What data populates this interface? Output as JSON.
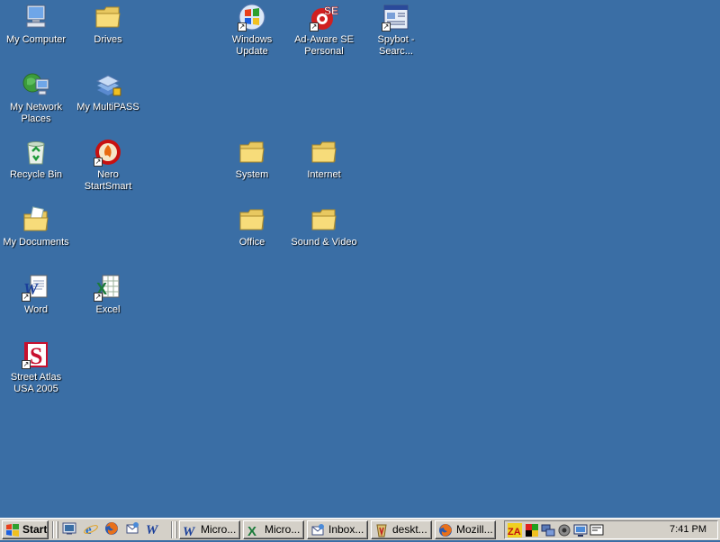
{
  "desktop": {
    "icons": [
      {
        "label": "My Computer",
        "icon": "computer-icon"
      },
      {
        "label": "Drives",
        "icon": "folder-icon"
      },
      {
        "label": "Windows Update",
        "icon": "windows-update-icon"
      },
      {
        "label": "Ad-Aware SE Personal",
        "icon": "ad-aware-icon"
      },
      {
        "label": "Spybot - Searc...",
        "icon": "spybot-icon"
      },
      {
        "label": "My Network Places",
        "icon": "network-places-icon"
      },
      {
        "label": "My MultiPASS",
        "icon": "multipass-icon"
      },
      {
        "label": "Recycle Bin",
        "icon": "recycle-bin-icon"
      },
      {
        "label": "Nero StartSmart",
        "icon": "nero-icon"
      },
      {
        "label": "System",
        "icon": "folder-icon"
      },
      {
        "label": "Internet",
        "icon": "folder-icon"
      },
      {
        "label": "My Documents",
        "icon": "documents-folder-icon"
      },
      {
        "label": "Office",
        "icon": "folder-icon"
      },
      {
        "label": "Sound & Video",
        "icon": "folder-icon"
      },
      {
        "label": "Word",
        "icon": "word-icon"
      },
      {
        "label": "Excel",
        "icon": "excel-icon"
      },
      {
        "label": "Street Atlas USA 2005",
        "icon": "street-atlas-icon"
      }
    ]
  },
  "taskbar": {
    "start_label": "Start",
    "quick_launch": [
      "show-desktop-icon",
      "internet-explorer-icon",
      "firefox-icon",
      "outlook-express-icon",
      "word-icon"
    ],
    "tasks": [
      {
        "label": "Micro...",
        "icon": "word-icon"
      },
      {
        "label": "Micro...",
        "icon": "excel-icon"
      },
      {
        "label": "Inbox...",
        "icon": "outlook-express-icon"
      },
      {
        "label": "deskt...",
        "icon": "image-editor-icon"
      },
      {
        "label": "Mozill...",
        "icon": "firefox-icon"
      }
    ],
    "tray_icons": [
      "zonealarm-icon",
      "color-app-icon",
      "network-icon",
      "speaker-icon",
      "monitor-icon",
      "display-icon"
    ],
    "clock": "7:41 PM"
  },
  "colors": {
    "desktop": "#3a6ea5",
    "taskbar": "#d4d0c8"
  }
}
